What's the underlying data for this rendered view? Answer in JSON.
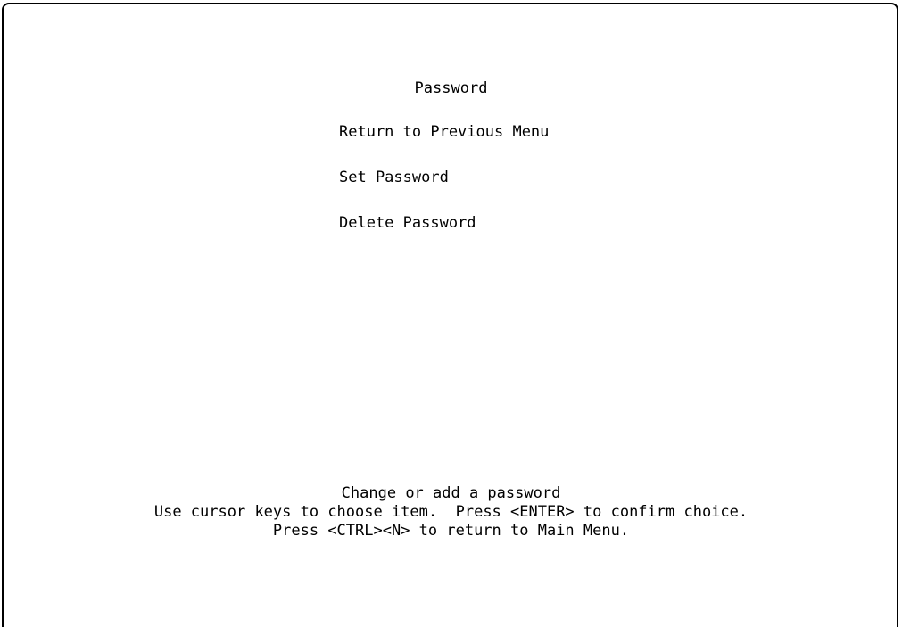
{
  "screen": {
    "title": "Password",
    "menu_items": [
      {
        "label": "Return to Previous Menu"
      },
      {
        "label": "Set Password"
      },
      {
        "label": "Delete Password"
      }
    ],
    "footer": {
      "description": "Change or add a password",
      "instructions": "Use cursor keys to choose item.  Press <ENTER> to confirm choice.",
      "return_hint": "Press <CTRL><N> to return to Main Menu."
    }
  }
}
